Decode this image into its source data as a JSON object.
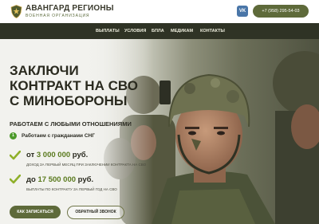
{
  "header": {
    "logo_title": "АВАНГАРД РЕГИОНЫ",
    "logo_subtitle": "ВОЕННАЯ ОРГАНИЗАЦИЯ",
    "vk_label": "VK",
    "phone": "+7 (958) 295-54-03"
  },
  "nav": {
    "items": [
      {
        "label": "ВЫПЛАТЫ"
      },
      {
        "label": "УСЛОВИЯ"
      },
      {
        "label": "БПЛА"
      },
      {
        "label": "МЕДИКАМ"
      },
      {
        "label": "КОНТАКТЫ"
      }
    ]
  },
  "hero": {
    "title_lines": [
      "ЗАКЛЮЧИ",
      "КОНТРАКТ НА СВО",
      "С МИНОБОРОНЫ"
    ],
    "subtitle": "РАБОТАЕМ С ЛЮБЫМИ ОТНОШЕНИЯМИ",
    "cis": {
      "number": "1",
      "text": "Работаем с гражданами СНГ"
    },
    "offers": [
      {
        "prefix": "от",
        "amount": "3 000 000",
        "unit": "руб.",
        "note": "ДОХОД ЗА ПЕРВЫЙ МЕСЯЦ ПРИ ЗАКЛЮЧЕНИИ КОНТРАКТА НА СВО"
      },
      {
        "prefix": "до",
        "amount": "17 500 000",
        "unit": "руб.",
        "note": "ВЫПЛАТЫ ПО КОНТРАКТУ ЗА ПЕРВЫЙ ГОД НА СВО"
      }
    ],
    "primary_button": "КАК ЗАПИСАТЬСЯ",
    "secondary_button": "ОБРАТНЫЙ ЗВОНОК"
  },
  "colors": {
    "accent_olive": "#5e6a3a",
    "nav_background": "#2f3325",
    "check_green": "#8fb02a",
    "vk_blue": "#4a76a8"
  },
  "icons": [
    "emblem-icon",
    "vk-icon",
    "check-icon",
    "number-badge"
  ]
}
